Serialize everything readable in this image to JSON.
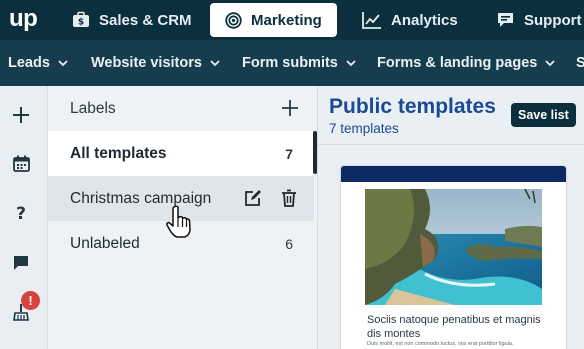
{
  "app": {
    "logo": "up"
  },
  "top_nav": {
    "tabs": [
      {
        "label": "Sales & CRM",
        "icon": "briefcase-icon"
      },
      {
        "label": "Marketing",
        "icon": "target-icon",
        "active": true
      },
      {
        "label": "Analytics",
        "icon": "chart-line-icon"
      },
      {
        "label": "Support",
        "icon": "chat-icon"
      }
    ]
  },
  "sub_nav": {
    "items": [
      {
        "label": "Leads"
      },
      {
        "label": "Website visitors"
      },
      {
        "label": "Form submits"
      },
      {
        "label": "Forms & landing pages"
      },
      {
        "label": "S"
      }
    ]
  },
  "rail": {
    "icons": [
      "plus-icon",
      "calendar-icon",
      "help-icon",
      "chat-icon",
      "broom-icon"
    ],
    "badge": "!"
  },
  "labels_panel": {
    "header": "Labels",
    "items": [
      {
        "label": "All templates",
        "count": "7",
        "selected": true
      },
      {
        "label": "Christmas campaign",
        "count": "",
        "hovered": true
      },
      {
        "label": "Unlabeled",
        "count": "6"
      }
    ]
  },
  "main": {
    "title": "Public templates",
    "count_text": "7 templates",
    "save_button": "Save list",
    "card": {
      "title": "Sociis natoque penatibus et magnis dis montes",
      "body": "Duis mollit, est non commodo luctus, nisi erat porttitor ligula."
    }
  },
  "colors": {
    "top_bar": "#0b2f3d",
    "sub_nav": "#163d4d",
    "accent_title": "#1a4a95",
    "card_band": "#0d2a63",
    "badge": "#d6453d"
  }
}
